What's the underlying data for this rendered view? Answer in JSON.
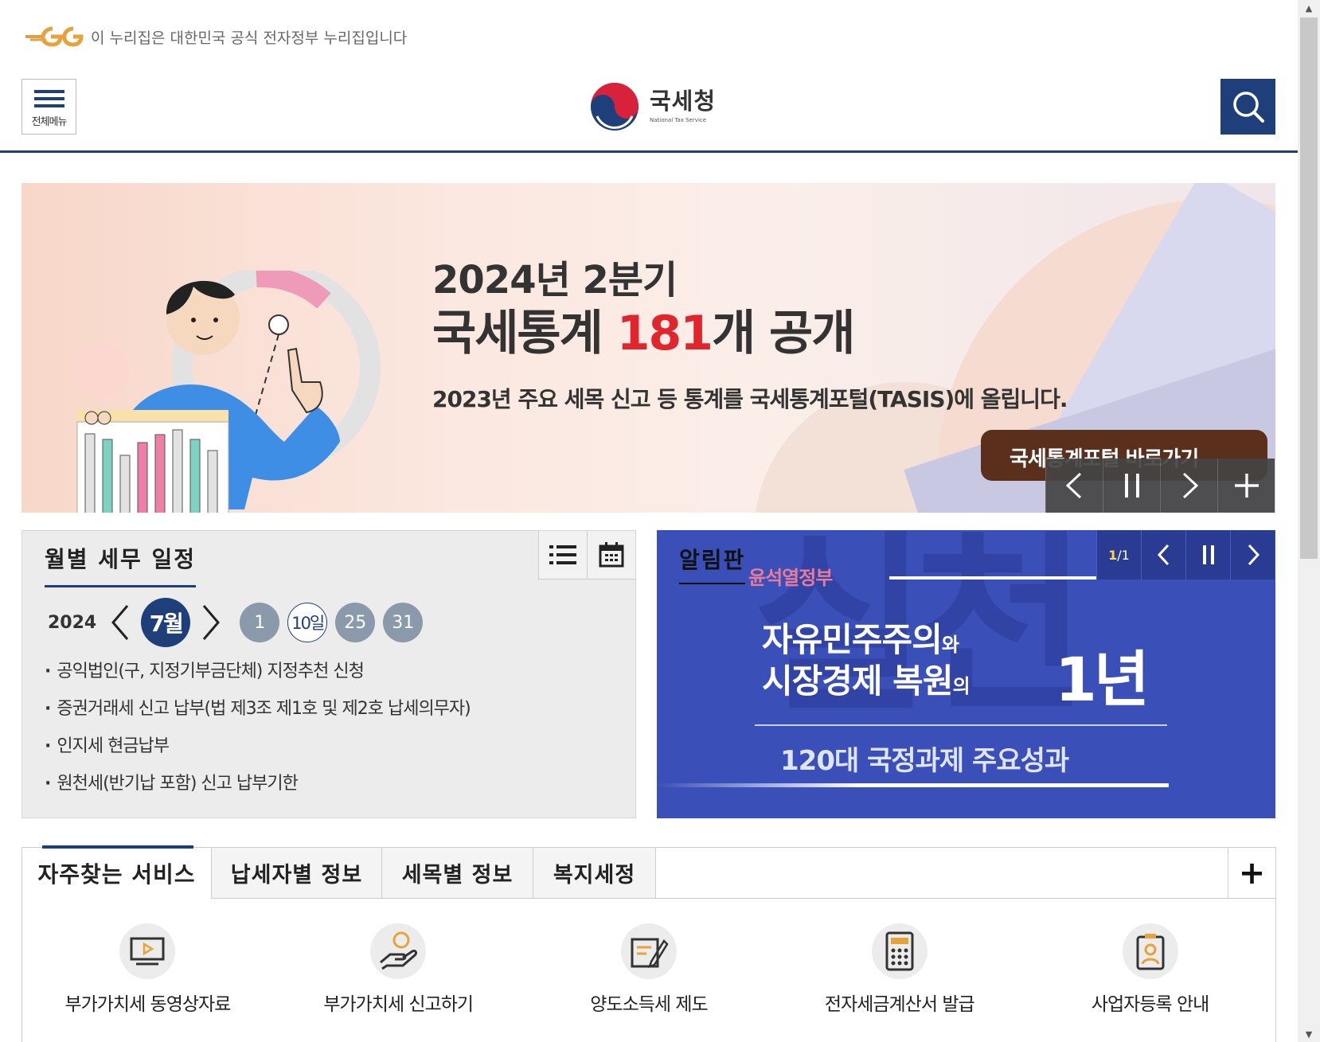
{
  "gov_banner": {
    "text": "이 누리집은 대한민국 공식 전자정부 누리집입니다",
    "logo": "eg-logo-icon"
  },
  "header": {
    "menu_label": "전체메뉴",
    "logo_name": "국세청",
    "logo_sub": "National Tax Service",
    "search_icon": "search-icon",
    "brand_color": "#1f3f7a"
  },
  "hero": {
    "line1": "2024년 2분기",
    "line2_a": "국세통계 ",
    "line2_b": "181",
    "line2_c": "개 공개",
    "line3": "2023년 주요 세목 신고 등 통계를 국세통계포털(TASIS)에 올립니다.",
    "cta": "국세통계포털 바로가기",
    "accent": "#e0252c",
    "controls": [
      "chevron-left-icon",
      "pause-icon",
      "chevron-right-icon",
      "plus-icon"
    ]
  },
  "schedule": {
    "title": "월별 세무 일정",
    "year": "2024",
    "month": "7월",
    "days": [
      "1",
      "10일",
      "25",
      "31"
    ],
    "active_day_index": 1,
    "events": [
      "공익법인(구, 지정기부금단체) 지정추천 신청",
      "증권거래세 신고 납부(법 제3조 제1호 및 제2호 납세의무자)",
      "인지세 현금납부",
      "원천세(반기납 포함) 신고 납부기한"
    ],
    "icons": [
      "list-icon",
      "calendar-icon"
    ]
  },
  "notice": {
    "title": "알림판",
    "strap": "윤석열정부",
    "line1_a": "자유민주주의",
    "line1_b": "와",
    "line2_a": "시장경제 복원",
    "line2_b": "의",
    "big": "1년",
    "line3": "120대 국정과제 주요성과",
    "watermark": "실천",
    "pager_current": "1",
    "pager_total": "1",
    "bg_color": "#3a4fb8"
  },
  "services": {
    "tabs": [
      "자주찾는 서비스",
      "납세자별 정보",
      "세목별 정보",
      "복지세정"
    ],
    "active_tab": 0,
    "plus": "+",
    "items": [
      {
        "label": "부가가치세 동영상자료",
        "icon": "video-icon"
      },
      {
        "label": "부가가치세 신고하기",
        "icon": "hand-coin-icon"
      },
      {
        "label": "양도소득세 제도",
        "icon": "document-pen-icon"
      },
      {
        "label": "전자세금계산서 발급",
        "icon": "calculator-icon"
      },
      {
        "label": "사업자등록 안내",
        "icon": "id-badge-icon"
      }
    ]
  }
}
